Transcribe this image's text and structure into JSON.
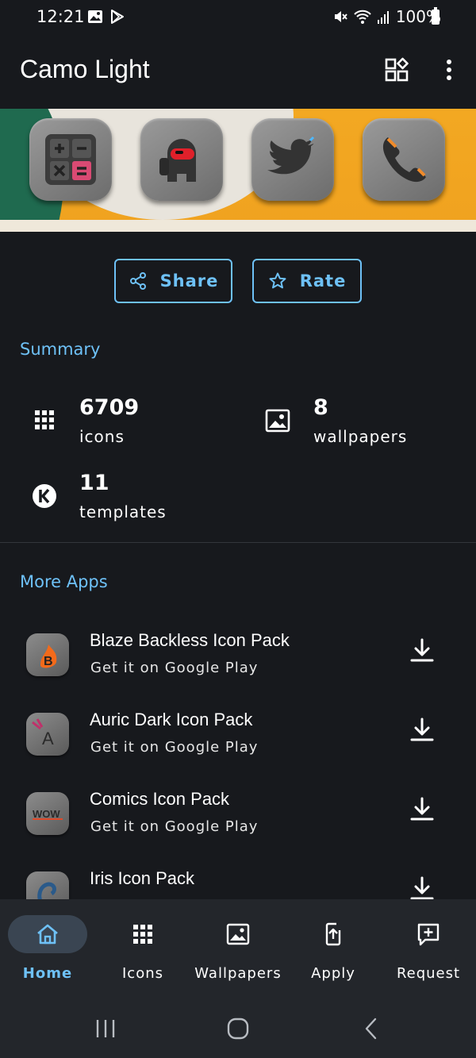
{
  "status_bar": {
    "time": "12:21",
    "battery": "100%"
  },
  "app_bar": {
    "title": "Camo Light"
  },
  "actions": {
    "share_label": "Share",
    "rate_label": "Rate"
  },
  "summary": {
    "title": "Summary",
    "icons": {
      "count": "6709",
      "label": "icons"
    },
    "wallpapers": {
      "count": "8",
      "label": "wallpapers"
    },
    "templates": {
      "count": "11",
      "label": "templates"
    }
  },
  "more_apps": {
    "title": "More Apps",
    "items": [
      {
        "name": "Blaze Backless Icon Pack",
        "subtitle": "Get it on Google Play"
      },
      {
        "name": "Auric Dark Icon Pack",
        "subtitle": "Get it on Google Play"
      },
      {
        "name": "Comics Icon Pack",
        "subtitle": "Get it on Google Play"
      },
      {
        "name": "Iris Icon Pack",
        "subtitle": ""
      }
    ]
  },
  "bottom_nav": {
    "items": [
      {
        "label": "Home",
        "icon": "home-icon",
        "active": true
      },
      {
        "label": "Icons",
        "icon": "grid-icon",
        "active": false
      },
      {
        "label": "Wallpapers",
        "icon": "image-icon",
        "active": false
      },
      {
        "label": "Apply",
        "icon": "apply-icon",
        "active": false
      },
      {
        "label": "Request",
        "icon": "request-icon",
        "active": false
      }
    ]
  },
  "colors": {
    "accent": "#6ec1f7",
    "background": "#17191d",
    "nav_background": "#23262b"
  }
}
